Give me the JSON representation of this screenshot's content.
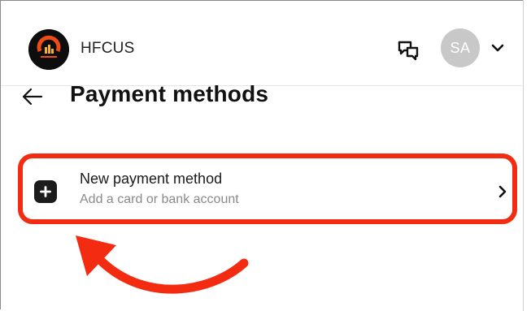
{
  "header": {
    "org_name": "HFCUS",
    "avatar_initials": "SA",
    "icons": {
      "chat": "chat-bubbles-icon",
      "menu": "chevron-down-icon"
    }
  },
  "page": {
    "title": "Payment methods",
    "back_icon": "arrow-left-icon"
  },
  "options": [
    {
      "title": "New payment method",
      "subtitle": "Add a card or bank account",
      "icon": "plus-icon",
      "trailing_icon": "chevron-right-icon"
    }
  ],
  "annotation": {
    "highlight_color": "#f32b10"
  },
  "colors": {
    "avatar_bg": "#c8c8c8",
    "text_primary": "#111111",
    "text_secondary": "#8a8a8a"
  }
}
